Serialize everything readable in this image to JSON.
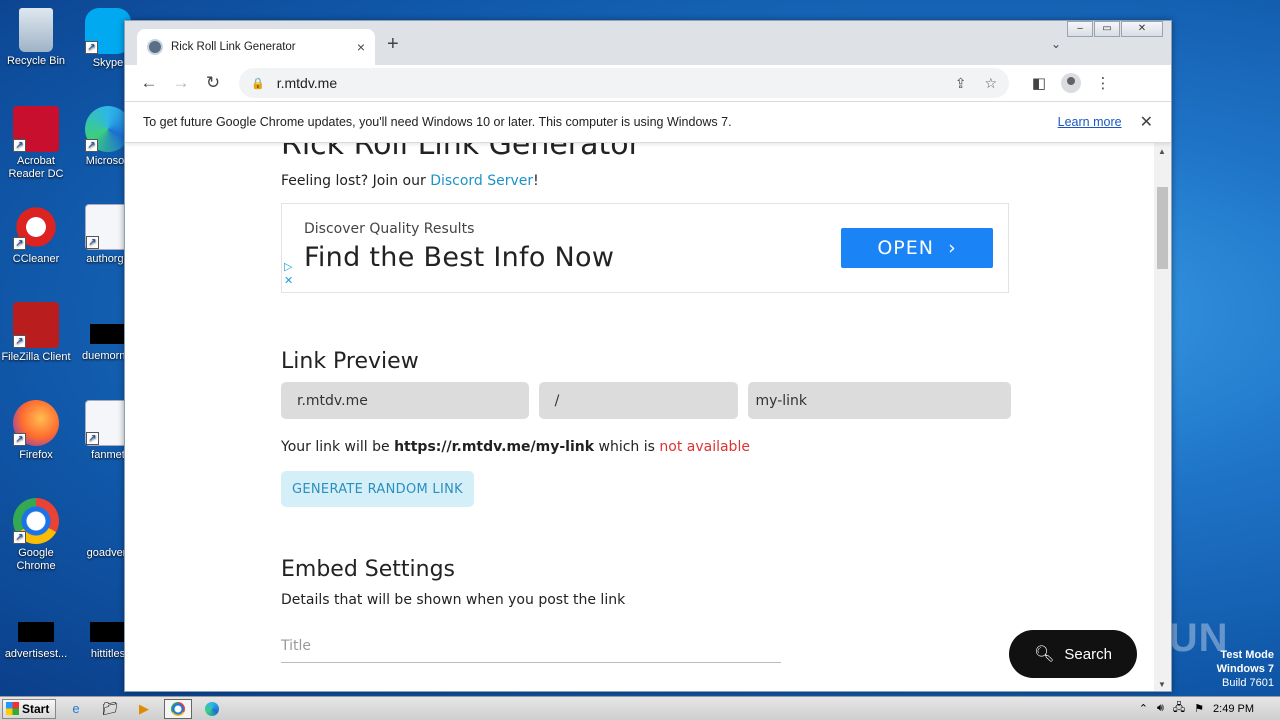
{
  "desktop": {
    "icons": [
      {
        "label": "Recycle Bin"
      },
      {
        "label": "Skype"
      },
      {
        "label": "Acrobat Reader DC"
      },
      {
        "label": "Microsoft"
      },
      {
        "label": "CCleaner"
      },
      {
        "label": "authorgo"
      },
      {
        "label": "FileZilla Client"
      },
      {
        "label": "duemornin"
      },
      {
        "label": "Firefox"
      },
      {
        "label": "fanmet"
      },
      {
        "label": "Google Chrome"
      },
      {
        "label": "goadvert"
      },
      {
        "label": "advertisest..."
      },
      {
        "label": "hittitles"
      }
    ],
    "watermark": "ANY RUN",
    "testmode": {
      "line1": "Test Mode",
      "line2": "Windows 7",
      "line3": "Build 7601"
    }
  },
  "browser": {
    "tab_title": "Rick Roll Link Generator",
    "tab_close": "×",
    "new_tab": "+",
    "address": "r.mtdv.me",
    "infobar": {
      "message": "To get future Google Chrome updates, you'll need Windows 10 or later. This computer is using Windows 7.",
      "learn_more": "Learn more",
      "close": "✕"
    }
  },
  "page": {
    "heading": "Rick Roll Link Generator",
    "lost_prefix": "Feeling lost? Join our ",
    "discord_link": "Discord Server",
    "lost_suffix": "!",
    "ad": {
      "small": "Discover Quality Results",
      "big": "Find the Best Info Now",
      "button": "OPEN"
    },
    "link_preview": {
      "title": "Link Preview",
      "domain": "r.mtdv.me",
      "slash": "/",
      "slug": "my-link",
      "your_link_prefix": "Your link will be ",
      "your_link_url": "https://r.mtdv.me/my-link",
      "your_link_mid": " which is ",
      "availability": "not available",
      "generate_button": "GENERATE RANDOM LINK"
    },
    "embed": {
      "title": "Embed Settings",
      "description": "Details that will be shown when you post the link",
      "title_placeholder": "Title"
    },
    "search_fab": "Search"
  },
  "taskbar": {
    "start": "Start",
    "time": "2:49 PM"
  }
}
